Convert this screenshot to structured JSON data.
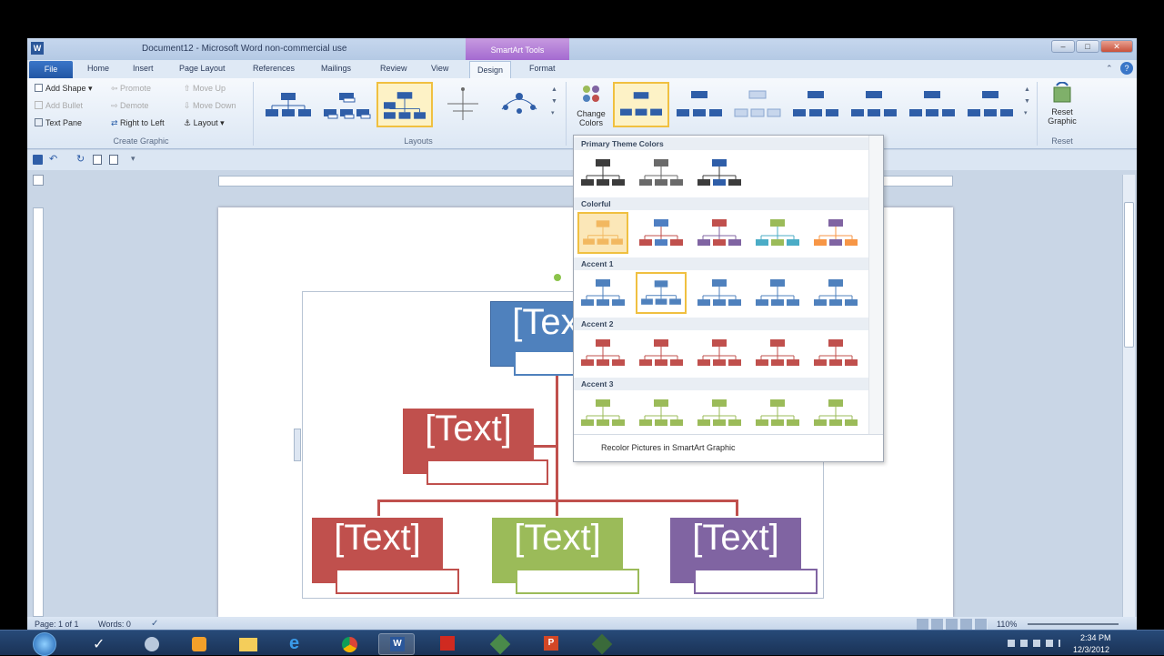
{
  "app": {
    "title": "Document12 - Microsoft Word non-commercial use",
    "contextual_tab": "SmartArt Tools",
    "tabs": [
      "File",
      "Home",
      "Insert",
      "Page Layout",
      "References",
      "Mailings",
      "Review",
      "View",
      "Design",
      "Format"
    ]
  },
  "ribbon": {
    "create_graphic": {
      "label": "Create Graphic",
      "add_shape": "Add Shape",
      "add_bullet": "Add Bullet",
      "text_pane": "Text Pane",
      "promote": "Promote",
      "demote": "Demote",
      "right_to_left": "Right to Left",
      "move_up": "Move Up",
      "move_down": "Move Down",
      "layout": "Layout"
    },
    "layouts_label": "Layouts",
    "change_colors": "Change Colors",
    "reset_graphic": "Reset Graphic",
    "reset_label": "Reset"
  },
  "gallery": {
    "sections": [
      {
        "name": "Primary Theme Colors",
        "swatches": [
          {
            "color": "#3c3c3c",
            "alt": "#3c3c3c"
          },
          {
            "color": "#6a6a6a",
            "alt": "#6a6a6a"
          },
          {
            "color": "#2f5ea8",
            "alt": "#3c3c3c"
          }
        ]
      },
      {
        "name": "Colorful",
        "swatches": [
          {
            "color": "#f2b860",
            "alt": "#f2b860"
          },
          {
            "color": "#4f7fc2",
            "alt": "#c0504d"
          },
          {
            "color": "#c0504d",
            "alt": "#8064a2"
          },
          {
            "color": "#9bbb59",
            "alt": "#4bacc6"
          },
          {
            "color": "#8064a2",
            "alt": "#f79646"
          }
        ]
      },
      {
        "name": "Accent 1",
        "swatches": [
          {
            "color": "#4f81bd",
            "alt": "#4f81bd"
          },
          {
            "color": "#4f81bd",
            "alt": "#4f81bd"
          },
          {
            "color": "#4f81bd",
            "alt": "#4f81bd"
          },
          {
            "color": "#4f81bd",
            "alt": "#4f81bd"
          },
          {
            "color": "#4f81bd",
            "alt": "#4f81bd"
          }
        ]
      },
      {
        "name": "Accent 2",
        "swatches": [
          {
            "color": "#c0504d",
            "alt": "#c0504d"
          },
          {
            "color": "#c0504d",
            "alt": "#c0504d"
          },
          {
            "color": "#c0504d",
            "alt": "#c0504d"
          },
          {
            "color": "#c0504d",
            "alt": "#c0504d"
          },
          {
            "color": "#c0504d",
            "alt": "#c0504d"
          }
        ]
      },
      {
        "name": "Accent 3",
        "swatches": [
          {
            "color": "#9bbb59",
            "alt": "#9bbb59"
          },
          {
            "color": "#9bbb59",
            "alt": "#9bbb59"
          },
          {
            "color": "#9bbb59",
            "alt": "#9bbb59"
          },
          {
            "color": "#9bbb59",
            "alt": "#9bbb59"
          },
          {
            "color": "#9bbb59",
            "alt": "#9bbb59"
          }
        ]
      }
    ],
    "recolor_label": "Recolor Pictures in SmartArt Graphic"
  },
  "smartart": {
    "top": {
      "text": "[Text]",
      "color": "#4f81bd"
    },
    "assistant": {
      "text": "[Text]",
      "color": "#c0504d"
    },
    "children": [
      {
        "text": "[Text]",
        "color": "#c0504d"
      },
      {
        "text": "[Text]",
        "color": "#9bbb59"
      },
      {
        "text": "[Text]",
        "color": "#8064a2"
      }
    ]
  },
  "status": {
    "page": "Page: 1 of 1",
    "words": "Words: 0",
    "zoom": "110%"
  },
  "clock": {
    "time": "2:34 PM",
    "date": "12/3/2012"
  }
}
